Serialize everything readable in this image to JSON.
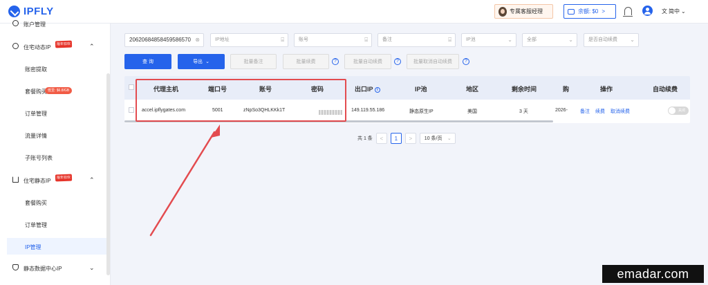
{
  "app": {
    "logo": "IPFLY"
  },
  "header": {
    "agent_label": "专属客服经理",
    "balance": "余额: $0",
    "balance_arrow": ">",
    "language": "简中",
    "language_arrow": "⌄"
  },
  "sidebar": {
    "items": [
      {
        "label": "账户管理"
      },
      {
        "label": "住宅动态IP",
        "badge": "限年狂欢"
      },
      {
        "label": "账密提取"
      },
      {
        "label": "套餐购买",
        "badge": "低至: $6.8/GB"
      },
      {
        "label": "订单管理"
      },
      {
        "label": "流量详情"
      },
      {
        "label": "子账号列表"
      },
      {
        "label": "住宅静态IP",
        "badge": "限年狂欢"
      },
      {
        "label": "套餐购买"
      },
      {
        "label": "订单管理"
      },
      {
        "label": "IP管理"
      },
      {
        "label": "静态数据中心IP"
      }
    ]
  },
  "filters": {
    "order_id": "20620684858459586570",
    "ip_placeholder": "IP地址",
    "account_placeholder": "账号",
    "remark_placeholder": "备注",
    "pool_placeholder": "IP池",
    "status": "全部",
    "auto_renew_placeholder": "是否自动续费"
  },
  "toolbar": {
    "query": "查 询",
    "export": "导出",
    "export_arrow": "⌄",
    "batch_remark": "批量备注",
    "batch_renew": "批量续费",
    "batch_auto_renew": "批量自动续费",
    "batch_cancel_auto_renew": "批量取消自动续费",
    "help": "?"
  },
  "table": {
    "headers": {
      "proxy_host": "代理主机",
      "port": "端口号",
      "account": "账号",
      "password": "密码",
      "exit_ip": "出口IP",
      "ip_pool": "IP池",
      "region": "地区",
      "remaining": "剩余时间",
      "purchase": "购",
      "actions": "操作",
      "auto_renew": "自动续费"
    },
    "row": {
      "proxy_host": "accel.ipflygates.com",
      "port": "5001",
      "account": "zNpSo3QHLKKk1T",
      "exit_ip": "149.119.55.186",
      "ip_pool": "静态原生IP",
      "region": "美国",
      "remaining": "3 天",
      "purchase": "2026-",
      "remark": "备注",
      "renew": "续费",
      "cancel_renew": "取消续费",
      "toggle": "关闭"
    }
  },
  "pagination": {
    "total": "共 1 条",
    "prev": "<",
    "page": "1",
    "next": ">",
    "page_size": "10 条/页"
  },
  "watermark": "emadar.com",
  "colors": {
    "primary": "#2563eb",
    "highlight": "#e34b4f",
    "background": "#f2f4fa"
  }
}
